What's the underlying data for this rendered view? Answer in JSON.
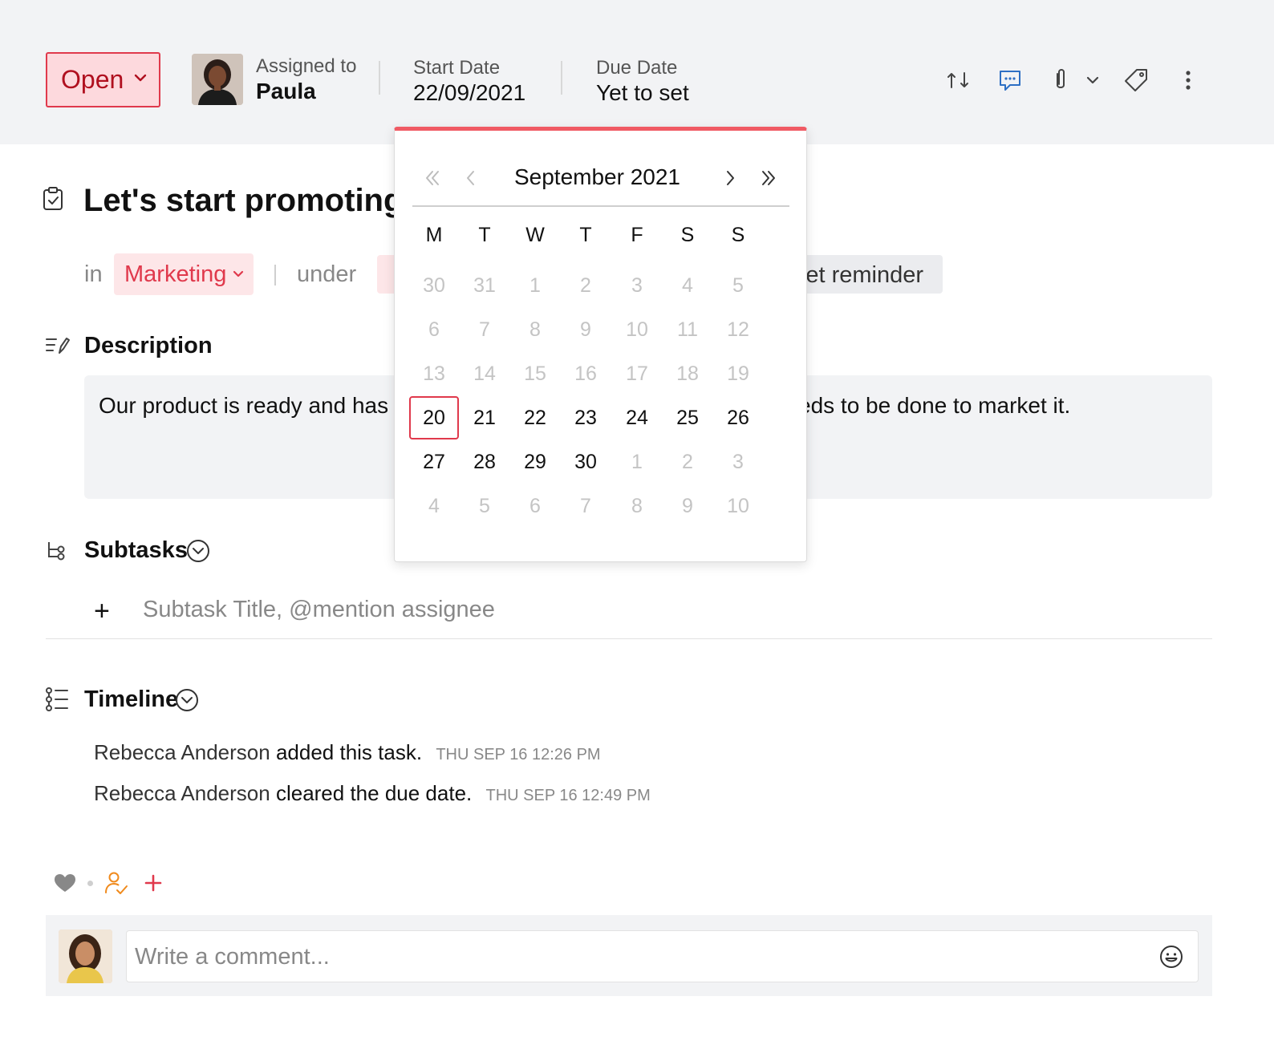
{
  "header": {
    "status": "Open",
    "assigned_label": "Assigned to",
    "assigned_name": "Paula",
    "start_label": "Start Date",
    "start_value": "22/09/2021",
    "due_label": "Due Date",
    "due_value": "Yet to set",
    "icons": [
      "swap-icon",
      "comment-icon",
      "attachment-icon",
      "chevron-down-icon",
      "tag-icon",
      "more-icon"
    ]
  },
  "task": {
    "title": "Let's start promoting S",
    "in_label": "in",
    "project": "Marketing",
    "under_label": "under",
    "reminder": "Set reminder"
  },
  "description": {
    "heading": "Description",
    "text_left": "Our product is ready and has p",
    "text_right": "eds to be done to market it."
  },
  "subtasks": {
    "heading": "Subtasks",
    "add": "+",
    "placeholder": "Subtask Title, @mention assignee"
  },
  "timeline": {
    "heading": "Timeline",
    "entries": [
      {
        "name": "Rebecca Anderson",
        "action": "added this task.",
        "time": "THU SEP 16 12:26 PM"
      },
      {
        "name": "Rebecca Anderson",
        "action": "cleared the due date.",
        "time": "THU SEP 16 12:49 PM"
      }
    ]
  },
  "reactions": {
    "add": "+"
  },
  "comment": {
    "placeholder": "Write a comment..."
  },
  "calendar": {
    "month": "September 2021",
    "weekdays": [
      "M",
      "T",
      "W",
      "T",
      "F",
      "S",
      "S"
    ],
    "selected": "20",
    "weeks": [
      [
        {
          "d": "30",
          "out": true
        },
        {
          "d": "31",
          "out": true
        },
        {
          "d": "1",
          "out": true
        },
        {
          "d": "2",
          "out": true
        },
        {
          "d": "3",
          "out": true
        },
        {
          "d": "4",
          "out": true
        },
        {
          "d": "5",
          "out": true
        }
      ],
      [
        {
          "d": "6",
          "out": true
        },
        {
          "d": "7",
          "out": true
        },
        {
          "d": "8",
          "out": true
        },
        {
          "d": "9",
          "out": true
        },
        {
          "d": "10",
          "out": true
        },
        {
          "d": "11",
          "out": true
        },
        {
          "d": "12",
          "out": true
        }
      ],
      [
        {
          "d": "13",
          "out": true
        },
        {
          "d": "14",
          "out": true
        },
        {
          "d": "15",
          "out": true
        },
        {
          "d": "16",
          "out": true
        },
        {
          "d": "17",
          "out": true
        },
        {
          "d": "18",
          "out": true
        },
        {
          "d": "19",
          "out": true
        }
      ],
      [
        {
          "d": "20",
          "out": false
        },
        {
          "d": "21",
          "out": false
        },
        {
          "d": "22",
          "out": false
        },
        {
          "d": "23",
          "out": false
        },
        {
          "d": "24",
          "out": false
        },
        {
          "d": "25",
          "out": false
        },
        {
          "d": "26",
          "out": false
        }
      ],
      [
        {
          "d": "27",
          "out": false
        },
        {
          "d": "28",
          "out": false
        },
        {
          "d": "29",
          "out": false
        },
        {
          "d": "30",
          "out": false
        },
        {
          "d": "1",
          "out": true
        },
        {
          "d": "2",
          "out": true
        },
        {
          "d": "3",
          "out": true
        }
      ],
      [
        {
          "d": "4",
          "out": true
        },
        {
          "d": "5",
          "out": true
        },
        {
          "d": "6",
          "out": true
        },
        {
          "d": "7",
          "out": true
        },
        {
          "d": "8",
          "out": true
        },
        {
          "d": "9",
          "out": true
        },
        {
          "d": "10",
          "out": true
        }
      ]
    ]
  },
  "colors": {
    "accent": "#e0394c",
    "calendar_top": "#f05a64",
    "header_bg": "#f2f3f5",
    "assignee_icon": "#f08a1c"
  }
}
